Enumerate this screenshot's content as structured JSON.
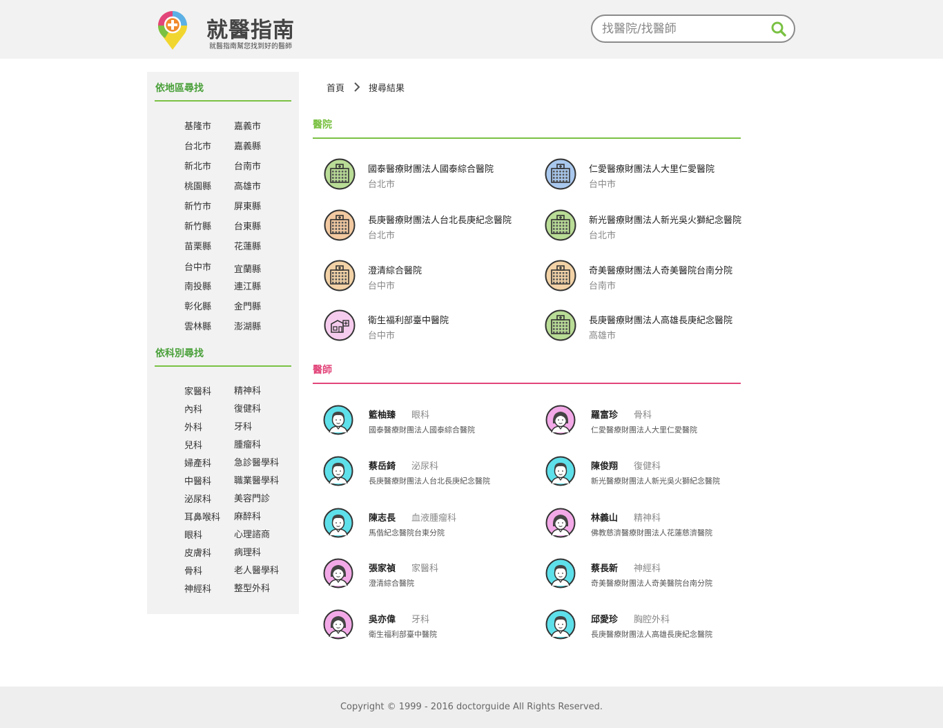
{
  "header": {
    "brand": "就醫指南",
    "tagline": "就醫指南幫您找到好的醫師",
    "search_placeholder": "找醫院/找醫師"
  },
  "sidebar": {
    "region_title": "依地區尋找",
    "regions_left": [
      "基隆市",
      "台北市",
      "新北市",
      "桃園縣",
      "新竹市",
      "新竹縣",
      "苗栗縣",
      "台中市",
      "南投縣",
      "彰化縣",
      "雲林縣"
    ],
    "regions_right": [
      "嘉義市",
      "嘉義縣",
      "台南市",
      "高雄市",
      "屏東縣",
      "台東縣",
      "花蓮縣",
      "宜蘭縣",
      "連江縣",
      "金門縣",
      "澎湖縣"
    ],
    "dept_title": "依科別尋找",
    "depts_left": [
      "家醫科",
      "內科",
      "外科",
      "兒科",
      "婦產科",
      "中醫科",
      "泌尿科",
      "耳鼻喉科",
      "眼科",
      "皮膚科",
      "骨科",
      "神經科"
    ],
    "depts_right": [
      "精神科",
      "復健科",
      "牙科",
      "腫瘤科",
      "急診醫學科",
      "職業醫學科",
      "美容門診",
      "麻醉科",
      "心理諮商",
      "病理科",
      "老人醫學科",
      "整型外科"
    ]
  },
  "breadcrumb": {
    "home": "首頁",
    "current": "搜尋結果"
  },
  "hospitals_section": {
    "title": "醫院",
    "accent": "#7ac143",
    "items": [
      {
        "name": "國泰醫療財團法人國泰綜合醫院",
        "city": "台北市",
        "icon": "hospital-building-icon",
        "color": "#b9dc96"
      },
      {
        "name": "仁愛醫療財團法人大里仁愛醫院",
        "city": "台中市",
        "icon": "hospital-building-icon",
        "color": "#a9c8ee"
      },
      {
        "name": "長庚醫療財團法人台北長庚紀念醫院",
        "city": "台北市",
        "icon": "hospital-building-icon",
        "color": "#f2c9a1"
      },
      {
        "name": "新光醫療財團法人新光吳火獅紀念醫院",
        "city": "台北市",
        "icon": "hospital-building-icon",
        "color": "#b9dc96"
      },
      {
        "name": "澄清綜合醫院",
        "city": "台中市",
        "icon": "hospital-building-icon",
        "color": "#f2d2a6"
      },
      {
        "name": "奇美醫療財團法人奇美醫院台南分院",
        "city": "台南市",
        "icon": "hospital-building-icon",
        "color": "#f2d2a6"
      },
      {
        "name": "衛生福利部臺中醫院",
        "city": "台中市",
        "icon": "clinic-house-icon",
        "color": "#f6ccee"
      },
      {
        "name": "長庚醫療財團法人高雄長庚紀念醫院",
        "city": "高雄市",
        "icon": "hospital-building-icon",
        "color": "#b9dc96"
      }
    ]
  },
  "doctors_section": {
    "title": "醫師",
    "accent": "#e2457a",
    "items": [
      {
        "name": "籃柚臻",
        "specialty": "眼科",
        "hospital": "國泰醫療財團法人國泰綜合醫院",
        "icon": "male-doctor-icon",
        "color": "#5ee0ea"
      },
      {
        "name": "羅富珍",
        "specialty": "骨科",
        "hospital": "仁愛醫療財團法人大里仁愛醫院",
        "icon": "female-doctor-icon",
        "color": "#f3a9e7"
      },
      {
        "name": "蔡岳錡",
        "specialty": "泌尿科",
        "hospital": "長庚醫療財團法人台北長庚紀念醫院",
        "icon": "male-doctor-icon",
        "color": "#5ee0ea"
      },
      {
        "name": "陳俊翔",
        "specialty": "復健科",
        "hospital": "新光醫療財團法人新光吳火獅紀念醫院",
        "icon": "male-doctor-icon",
        "color": "#5ee0ea"
      },
      {
        "name": "陳志長",
        "specialty": "血液腫瘤科",
        "hospital": "馬偕紀念醫院台東分院",
        "icon": "male-doctor-icon",
        "color": "#5ee0ea"
      },
      {
        "name": "林義山",
        "specialty": "精神科",
        "hospital": "佛教慈濟醫療財團法人花蓮慈濟醫院",
        "icon": "female-doctor-icon",
        "color": "#f3a9e7"
      },
      {
        "name": "張家禎",
        "specialty": "家醫科",
        "hospital": "澄清綜合醫院",
        "icon": "female-doctor-icon",
        "color": "#f3a9e7"
      },
      {
        "name": "蔡長新",
        "specialty": "神經科",
        "hospital": "奇美醫療財團法人奇美醫院台南分院",
        "icon": "male-doctor-icon",
        "color": "#5ee0ea"
      },
      {
        "name": "吳亦偉",
        "specialty": "牙科",
        "hospital": "衛生福利部臺中醫院",
        "icon": "female-doctor-icon",
        "color": "#f3a9e7"
      },
      {
        "name": "邱愛珍",
        "specialty": "胸腔外科",
        "hospital": "長庚醫療財團法人高雄長庚紀念醫院",
        "icon": "male-doctor-icon",
        "color": "#5ee0ea"
      }
    ]
  },
  "footer": {
    "copyright": "Copyright © 1999 - 2016 doctorguide All Rights Reserved."
  }
}
